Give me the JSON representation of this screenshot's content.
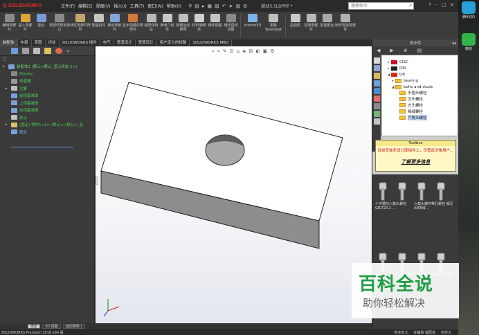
{
  "app": {
    "logo_text": "SOLIDWORKS",
    "document_title": "被动3.SLDPRT *",
    "menus": [
      "文件(F)",
      "编辑(E)",
      "视图(V)",
      "插入(I)",
      "工具(T)",
      "窗口(W)",
      "帮助(H)"
    ],
    "search_placeholder": "搜索命令",
    "window_controls": [
      "?",
      "-",
      "□",
      "×"
    ]
  },
  "ribbon": {
    "buttons": [
      {
        "label": "编辑零部件",
        "color": "#8a8a8a"
      },
      {
        "label": "插入零部件",
        "color": "#d9a63a"
      },
      {
        "label": "配合",
        "color": "#7a9bd1"
      },
      {
        "label": "零部件预览窗口",
        "color": "#8a8a8a"
      },
      {
        "label": "线性零部件阵列",
        "color": "#c1a86a"
      },
      {
        "label": "智能扣件",
        "color": "#c5c5c5"
      },
      {
        "label": "移动零部件",
        "color": "#7fa7d8"
      },
      {
        "label": "显示隐藏的零部件",
        "color": "#d27a3a"
      },
      {
        "label": "装配体特征",
        "color": "#b9b9b9"
      },
      {
        "label": "参考几何体",
        "color": "#c9c9c9"
      },
      {
        "label": "新建运动算例",
        "color": "#bdbdbd"
      },
      {
        "label": "材料明细表",
        "color": "#d0d0d0"
      },
      {
        "label": "爆炸视图",
        "color": "#c4c4c4"
      },
      {
        "label": "爆炸直线草图",
        "color": "#8a8a8a"
      },
      {
        "label": "Instant3D",
        "color": "#7bb2e8"
      },
      {
        "label": "更新Speedpak",
        "color": "#c0c0c0"
      },
      {
        "label": "拍快照",
        "color": "#c9c9c9"
      },
      {
        "label": "替换零部件",
        "color": "#b8b8b8"
      },
      {
        "label": "智能配合",
        "color": "#a9a9a9"
      },
      {
        "label": "制作智能零部件",
        "color": "#b0b0b0"
      }
    ]
  },
  "tabs": [
    "装配体",
    "布局",
    "草图",
    "评估",
    "SOLIDWORKS 插件",
    "电气",
    "管道设计",
    "管筒设计",
    "用户定义的线路",
    "SOLIDWORKS MBD"
  ],
  "tree": {
    "filter_symbol": "▽",
    "items": [
      {
        "label": "装配体1 (默认<默认_显示状态-1>)",
        "color": "#6bd66b",
        "indent": 0,
        "icon_color": "#7aa0d8"
      },
      {
        "label": "History",
        "color": "#4fd14f",
        "indent": 1,
        "icon_color": "#8a8a8a"
      },
      {
        "label": "传感器",
        "color": "#4fd14f",
        "indent": 1,
        "icon_color": "#9b9b9b"
      },
      {
        "label": "注解",
        "color": "#4fd14f",
        "indent": 1,
        "icon_color": "#bfbfbf"
      },
      {
        "label": "前视基准面",
        "color": "#4fd14f",
        "indent": 1,
        "icon_color": "#7aa0d8"
      },
      {
        "label": "上视基准面",
        "color": "#4fd14f",
        "indent": 1,
        "icon_color": "#7aa0d8"
      },
      {
        "label": "右视基准面",
        "color": "#4fd14f",
        "indent": 1,
        "icon_color": "#7aa0d8"
      },
      {
        "label": "原点",
        "color": "#4fd14f",
        "indent": 1,
        "icon_color": "#c0c0c0"
      },
      {
        "label": "(固定) 零件1<1> (默认<<默认>_显",
        "color": "#4fd14f",
        "indent": 1,
        "icon_color": "#d9c36a"
      },
      {
        "label": "配合",
        "color": "#7fb5ff",
        "indent": 1,
        "icon_color": "#7aa0d8"
      }
    ]
  },
  "heads_up": [
    "⌕",
    "⌖",
    "✎",
    "⊡",
    "⌂",
    "◈",
    "⊞",
    "◐",
    "▣",
    "⚙"
  ],
  "bottom_tabs": [
    "模型",
    "3D 视图",
    "运动算例 1"
  ],
  "status": {
    "left": "SOLIDWORKS Premium 2016 x64 版",
    "right": [
      "完全定义",
      "在编辑 装配体",
      "自定义"
    ]
  },
  "task_pane": {
    "title": "设计库",
    "library": [
      {
        "label": "CISC",
        "type": "flag",
        "color": "#c8102e",
        "indent": 1
      },
      {
        "label": "DIN",
        "type": "flag",
        "color": "#222222",
        "indent": 1
      },
      {
        "label": "GB",
        "type": "flag",
        "color": "#de2910",
        "indent": 1
      },
      {
        "label": "bearing",
        "type": "folder",
        "indent": 2
      },
      {
        "label": "bolts and studs",
        "type": "folder",
        "indent": 2
      },
      {
        "label": "半圆头螺栓",
        "type": "folder",
        "indent": 3
      },
      {
        "label": "沉头螺栓",
        "type": "folder",
        "indent": 3
      },
      {
        "label": "方头螺栓",
        "type": "folder",
        "indent": 3
      },
      {
        "label": "褐缝螺栓",
        "type": "folder",
        "indent": 3
      },
      {
        "label": "六角头螺栓",
        "type": "folder",
        "indent": 3,
        "selected": true
      }
    ],
    "toolbox": {
      "title": "Toolbox",
      "message": "目前安装至设计库插件上，尽管此对象用户...",
      "link": "了解更多信息"
    },
    "parts": [
      {
        "label": "十字槽凹六角头螺栓 GB/T29.2 ..."
      },
      {
        "label": "六角头螺杆带孔螺栓 细牙 A和B级..."
      },
      {
        "label": "六角头头部带孔螺栓 细牙 B级 GB..."
      },
      {
        "label": "六角头头部带槽螺栓 A和B级 GB/..."
      }
    ]
  },
  "desktop": {
    "items": [
      {
        "label": "腾讯QQ",
        "color": "#2a9ed8"
      },
      {
        "label": "微信",
        "color": "#33b34a"
      }
    ]
  },
  "watermark": {
    "title": "百科全说",
    "subtitle": "助你轻松解决"
  }
}
